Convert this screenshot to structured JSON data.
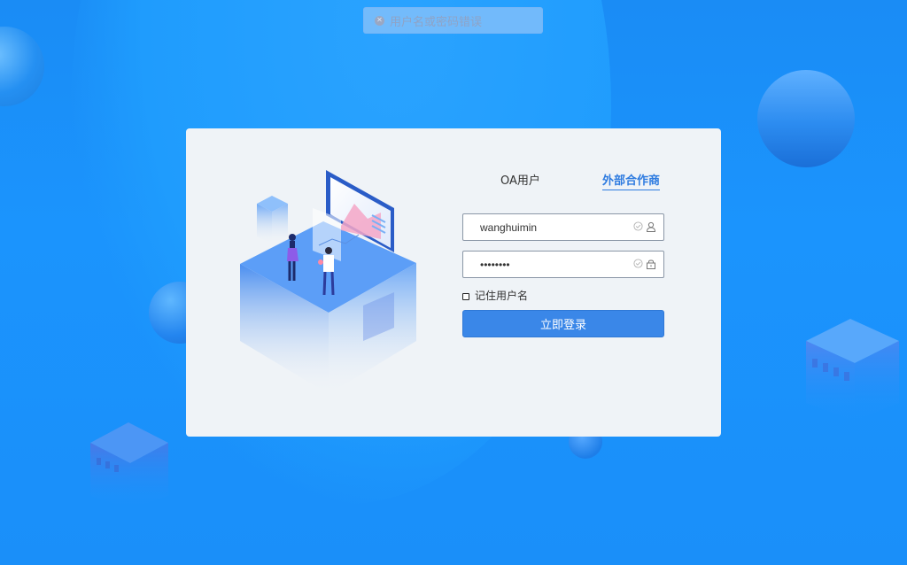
{
  "toast": {
    "message": "用户名或密码错误",
    "icon": "error-circle-icon"
  },
  "tabs": [
    {
      "label": "OA用户",
      "active": false
    },
    {
      "label": "外部合作商",
      "active": true
    }
  ],
  "form": {
    "username": {
      "value": "wanghuimin",
      "icon": "user-icon"
    },
    "password": {
      "value": "••••••••",
      "icon": "lock-icon"
    },
    "remember": {
      "label": "记住用户名",
      "checked": false
    },
    "submit_label": "立即登录"
  },
  "colors": {
    "background": "#1b94fd",
    "accent": "#3a87e8",
    "card": "#eff3f7",
    "active_tab": "#2e7be0"
  }
}
